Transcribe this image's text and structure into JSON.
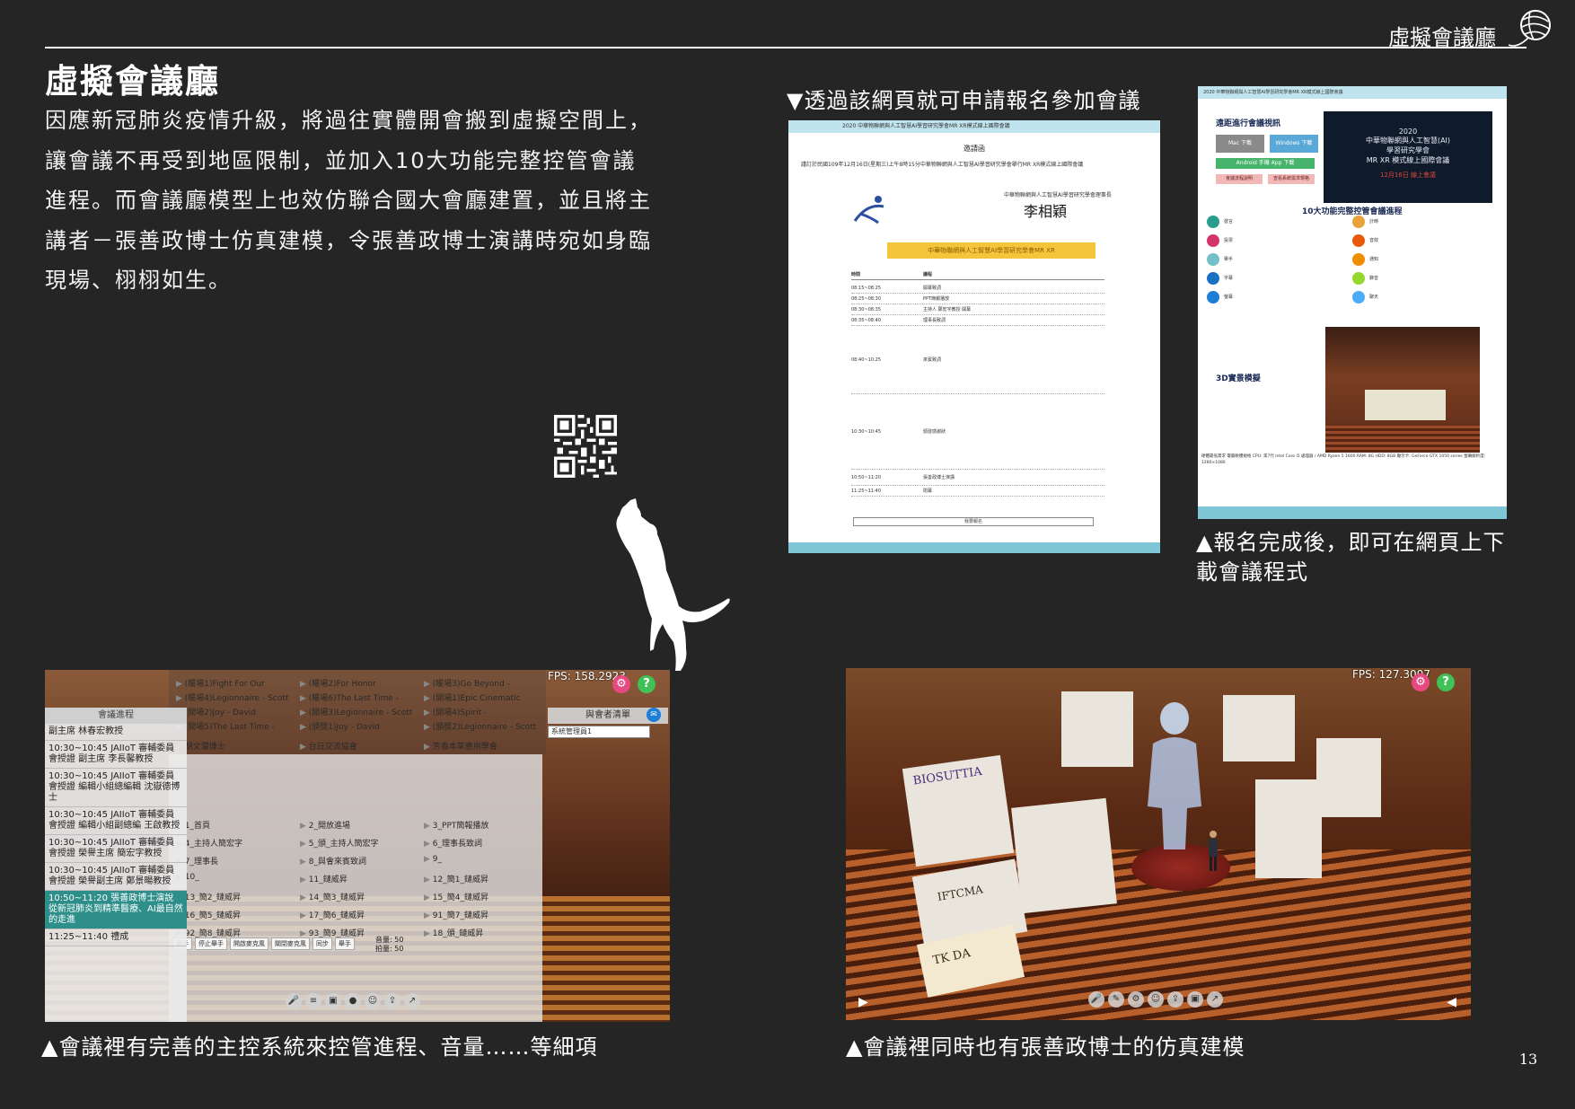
{
  "header": {
    "title": "虛擬會議廳"
  },
  "intro": {
    "title": "虛擬會議廳",
    "body": "因應新冠肺炎疫情升級，將過往實體開會搬到虛擬空間上，讓會議不再受到地區限制，並加入10大功能完整控管會議進程。而會議廳模型上也效仿聯合國大會廳建置，並且將主講者－張善政博士仿真建模，令張善政博士演講時宛如身臨現場、栩栩如生。"
  },
  "captions": {
    "registration": "▼透過該網頁就可申請報名參加會議",
    "download": "▲報名完成後，即可在網頁上下載會議程式",
    "control": "▲會議裡有完善的主控系統來控管進程、音量……等細項",
    "avatar": "▲會議裡同時也有張善政博士的仿真建模"
  },
  "invite_doc": {
    "topbar": "2020 中華物聯網與人工智慧AI學習研究學會MR XR模式線上國際會議",
    "heading": "邀請函",
    "para": "謹訂於民國109年12月16日(星期三)上午8時15分中華物聯網與人工智慧AI學習研究學會舉行MR XR模式線上國際會議",
    "org": "中華物聯網與人工智慧AI學習研究學會理事長",
    "signature": "李相穎",
    "banner": "中華物聯網與人工智慧AI學習研究學會MR XR",
    "sched_headers": [
      "時間",
      "議程"
    ],
    "sched_rows": [
      [
        "08:15~08:25",
        "開幕致詞"
      ],
      [
        "08:25~08:30",
        "PPT簡報播放"
      ],
      [
        "08:30~08:35",
        "主持人 鄭宏字教授 開幕"
      ],
      [
        "08:35~08:40",
        "理事長致詞"
      ],
      [
        "08:40~10:25",
        "來賓致詞"
      ],
      [
        "10:30~10:45",
        "頒發感謝狀"
      ],
      [
        "10:50~11:20",
        "張善政博士演講"
      ],
      [
        "11:25~11:40",
        "閉幕"
      ]
    ],
    "button": "我要報名"
  },
  "download_doc": {
    "topbar": "2020 中華物聯網與人工智慧AI學習研究學會MR XR模式線上國際會議",
    "section_join": "遠距進行會議視訊",
    "hero_line1": "2020",
    "hero_line2": "中華物聯網與人工智慧(AI)",
    "hero_line3": "學習研究學會",
    "hero_line4": "MR XR 模式線上國際會議",
    "hero_red": "12月16日 線上會議",
    "btn_mac": "Mac 下載",
    "btn_windows": "Windows 下載",
    "btn_android": "Android 手機 App 下載",
    "btn_pink1": "會議流程說明",
    "btn_pink2": "查看系統需求規格",
    "section_features": "10大功能完整控管會議進程",
    "features": [
      "發言",
      "計時",
      "投票",
      "音效",
      "舉手",
      "通知",
      "字幕",
      "錄音",
      "螢幕",
      "聊天"
    ],
    "section_3d": "3D實景模擬",
    "bottom": "硬體最低需求 電腦軟體規格 CPU: 第7代 Intel Core i5 處理器 / AMD Ryzen 5 1600 RAM: 8G HDD: 8GB 顯示卡: GeForce GTX 1050 series 螢幕解析度: 1280×1080"
  },
  "shot1": {
    "fps": "FPS: 158.2923",
    "agenda_title": "會議進程",
    "agenda": [
      "副主席 林春宏教授",
      "10:30~10:45 JAIIoT 審輔委員會授證 副主席 李長馨教授",
      "10:30~10:45 JAIIoT 審輔委員會授證 編輯小組總編輯 沈嶽德博士",
      "10:30~10:45 JAIIoT 審輔委員會授證 編輯小組副總編 王啟教授",
      "10:30~10:45 JAIIoT 審輔委員會授證 榮譽主席 簡宏字教授",
      "10:30~10:45 JAIIoT 審輔委員會授證 榮譽副主席 鄭景暘教授",
      "10:50~11:20 張善政博士演說 從新冠肺炎到精準醫療、AI最自然的走進",
      "11:25~11:40 禮成"
    ],
    "music": [
      "(暖場1)Fight For Our",
      "(暖場2)For Honor",
      "(暖場3)Go Beyond -",
      "(暖場4)Legionnaire - Scott",
      "(暖場6)The Last Time -",
      "(開場1)Epic Cinematic",
      "(開場2)Joy - David",
      "(開場3)Legionnaire - Scott",
      "(開場4)Spirit -",
      "(開場5)The Last Time -",
      "(頒獎1)Joy - David",
      "(頒獎2)Legionnaire - Scott",
      "胡文瀾博士",
      "台日交流協會",
      "芳香本草應用學會"
    ],
    "commands": [
      "1_首頁",
      "2_開放進場",
      "3_PPT簡報播放",
      "4_主持人簡宏字",
      "5_頒_主持人簡宏字",
      "6_理事長致詞",
      "7_理事長",
      "8_與會來賓致詞",
      "9_",
      "10_",
      "11_鏈威昇",
      "12_簡1_鏈威昇",
      "13_簡2_鏈威昇",
      "14_簡3_鏈威昇",
      "15_簡4_鏈威昇",
      "16_簡5_鏈威昇",
      "17_簡6_鏈威昇",
      "91_簡7_鏈威昇",
      "92_簡8_鏈威昇",
      "93_簡9_鏈威昇",
      "18_頒_鏈威昇"
    ],
    "controls": [
      "舉手",
      "停止舉手",
      "開啟麥克風",
      "關閉麥克風",
      "同步",
      "舉手"
    ],
    "volume_label": "音量: 50",
    "effects_label": "拍量: 50",
    "participants_title": "與會者清單",
    "admin_label": "系統管理員1"
  },
  "shot2": {
    "fps": "FPS: 127.3007",
    "sponsor1": "BIOSUTTIA",
    "sponsor2": "IFTCMA",
    "sponsor3": "TK DA"
  },
  "page_number": "13"
}
